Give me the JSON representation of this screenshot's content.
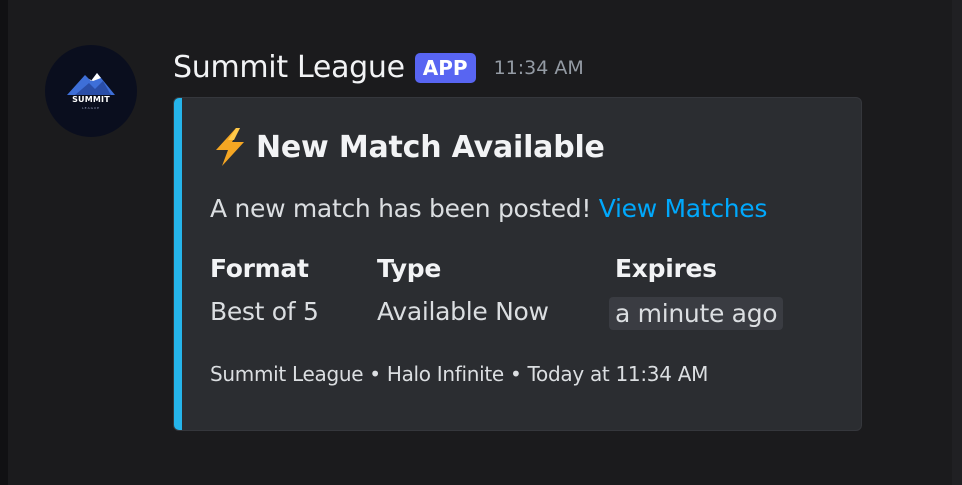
{
  "message": {
    "author": "Summit League",
    "badge": "APP",
    "timestamp": "11:34 AM",
    "avatar": {
      "icon": "summit-league-logo",
      "text": "SUMMIT",
      "subtext": "LEAGUE"
    }
  },
  "embed": {
    "accent_color": "#25b4ea",
    "icon": "lightning-bolt",
    "title": "New Match Available",
    "description": "A new match has been posted! ",
    "link_text": "View Matches",
    "fields": [
      {
        "name": "Format",
        "value": "Best of 5"
      },
      {
        "name": "Type",
        "value": "Available Now"
      },
      {
        "name": "Expires",
        "value": "a minute ago"
      }
    ],
    "footer": "Summit League • Halo Infinite • Today at 11:34 AM"
  },
  "colors": {
    "background": "#1b1b1d",
    "embed_background": "#2b2d31",
    "app_badge": "#5865f2",
    "link": "#00a8fc"
  }
}
